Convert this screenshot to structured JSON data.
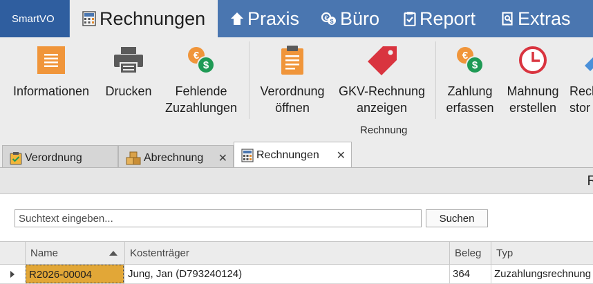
{
  "app": {
    "name": "SmartVO"
  },
  "menu": {
    "tabs": [
      {
        "label": "Rechnungen",
        "icon": "calculator-icon",
        "active": true
      },
      {
        "label": "Praxis",
        "icon": "home-icon",
        "active": false
      },
      {
        "label": "Büro",
        "icon": "money-icon",
        "active": false
      },
      {
        "label": "Report",
        "icon": "clipboard-check-icon",
        "active": false
      },
      {
        "label": "Extras",
        "icon": "document-search-icon",
        "active": false
      }
    ]
  },
  "ribbon": {
    "buttons": [
      {
        "label": "Informationen",
        "icon": "list-icon"
      },
      {
        "label": "Drucken",
        "icon": "printer-icon"
      },
      {
        "label": "Fehlende\nZuzahlungen",
        "icon": "euro-dollar-coins-icon"
      },
      {
        "label": "Verordnung\nöffnen",
        "icon": "clipboard-icon"
      },
      {
        "label": "GKV-Rechnung\nanzeigen",
        "icon": "tag-icon"
      },
      {
        "label": "Zahlung\nerfassen",
        "icon": "euro-dollar-coins-icon"
      },
      {
        "label": "Mahnung\nerstellen",
        "icon": "clock-icon"
      },
      {
        "label": "Rech\nstor",
        "icon": "partial-icon"
      }
    ],
    "group_label": "Rechnung"
  },
  "doc_tabs": [
    {
      "label": "Verordnung",
      "icon": "clipboard-check-icon",
      "active": false,
      "closable": false
    },
    {
      "label": "Abrechnung",
      "icon": "boxes-icon",
      "active": false,
      "closable": true
    },
    {
      "label": "Rechnungen",
      "icon": "calculator-icon",
      "active": true,
      "closable": true
    }
  ],
  "content": {
    "header_title": "R",
    "search": {
      "placeholder": "Suchtext eingeben...",
      "value": "",
      "button_label": "Suchen"
    },
    "table": {
      "columns": [
        "Name",
        "Kostenträger",
        "Beleg",
        "Typ"
      ],
      "sorted_column": "Name",
      "sort_direction": "ascending",
      "rows": [
        {
          "name": "R2026-00004",
          "kostentraeger": "Jung, Jan (D793240124)",
          "beleg": "364",
          "typ": "Zuzahlungsrechnung"
        }
      ]
    }
  },
  "colors": {
    "menubar": "#4a76b0",
    "app_name_bg": "#2f5e9f",
    "ribbon_bg": "#ececec",
    "selection": "#e2a737",
    "orange": "#f0953a",
    "red": "#d9343f",
    "green": "#1f9a55"
  }
}
